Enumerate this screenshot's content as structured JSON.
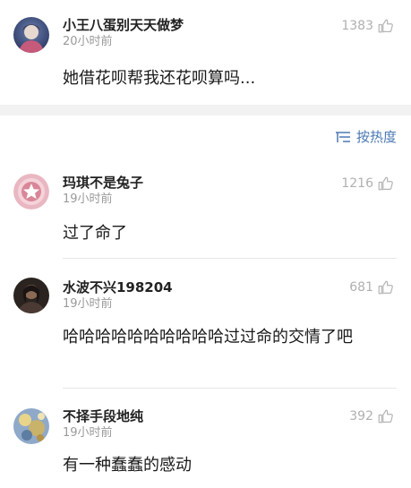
{
  "comments_top": [
    {
      "name": "小王八蛋别天天做梦",
      "time": "20小时前",
      "likes": "1383",
      "text": "她借花呗帮我还花呗算吗..."
    }
  ],
  "sort": {
    "label": "按热度"
  },
  "comments": [
    {
      "name": "玛琪不是兔子",
      "time": "19小时前",
      "likes": "1216",
      "text": "过了命了"
    },
    {
      "name": "水波不兴198204",
      "time": "19小时前",
      "likes": "681",
      "text": "哈哈哈哈哈哈哈哈哈哈过过命的交情了吧"
    },
    {
      "name": "不择手段地纯",
      "time": "19小时前",
      "likes": "392",
      "text": "有一种蠢蠢的感动"
    }
  ],
  "colors": {
    "accent": "#4c79b4",
    "muted": "#9a9a9a",
    "like": "#b0b0b0",
    "separator": "#f2f2f2"
  },
  "icons": {
    "like": "thumbs-up-icon",
    "sort": "sort-lines-icon"
  }
}
